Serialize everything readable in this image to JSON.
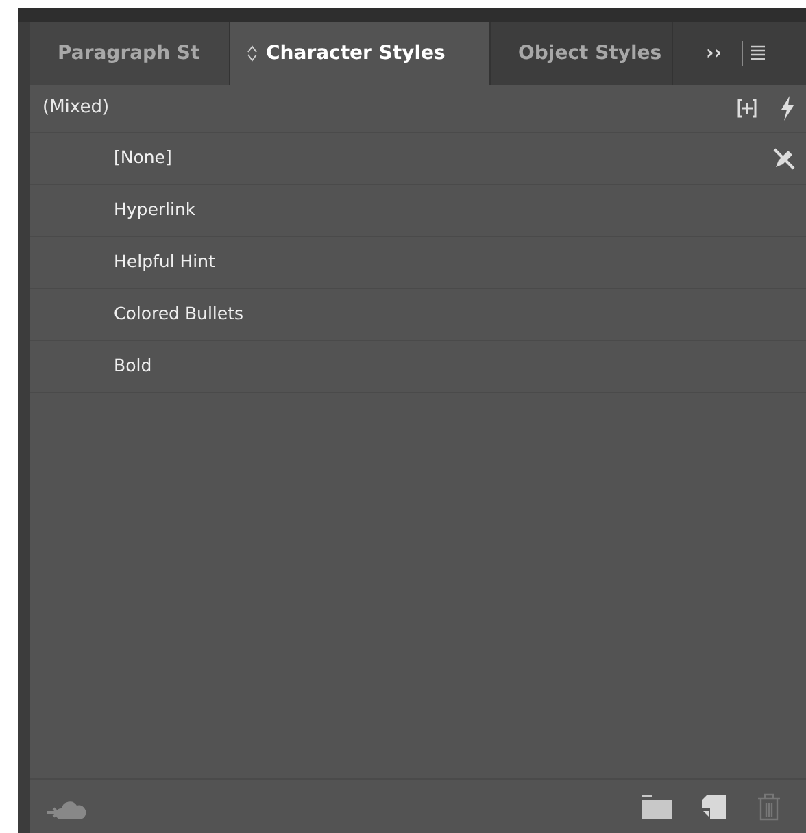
{
  "tabs": [
    {
      "label": "Paragraph St",
      "selected": false
    },
    {
      "label": "Character Styles",
      "selected": true
    },
    {
      "label": "Object Styles",
      "selected": false
    }
  ],
  "overflow": "››",
  "current_style": "(Mixed)",
  "styles": [
    {
      "label": "[None]",
      "editable": false
    },
    {
      "label": "Hyperlink",
      "editable": true
    },
    {
      "label": "Helpful Hint",
      "editable": true
    },
    {
      "label": "Colored Bullets",
      "editable": true
    },
    {
      "label": "Bold",
      "editable": true
    }
  ]
}
